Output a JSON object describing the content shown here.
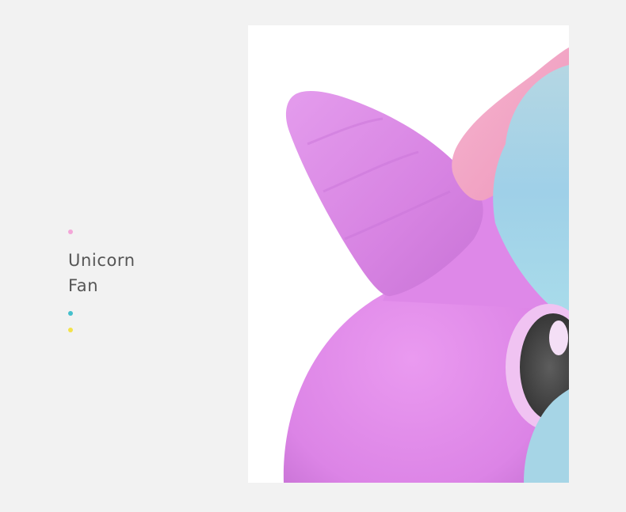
{
  "caption": {
    "line1": "Unicorn",
    "line2": "Fan"
  },
  "accent_dots": {
    "top": "#f3a6d8",
    "middle": "#45c0cc",
    "bottom": "#f3e24a"
  },
  "photo": {
    "subject": "pink-unicorn-toy-closeup",
    "colors": {
      "body": "#e08be8",
      "mane": "#a6d2e4",
      "bow": "#f3a9c8",
      "eye": "#4c4c4c"
    }
  }
}
